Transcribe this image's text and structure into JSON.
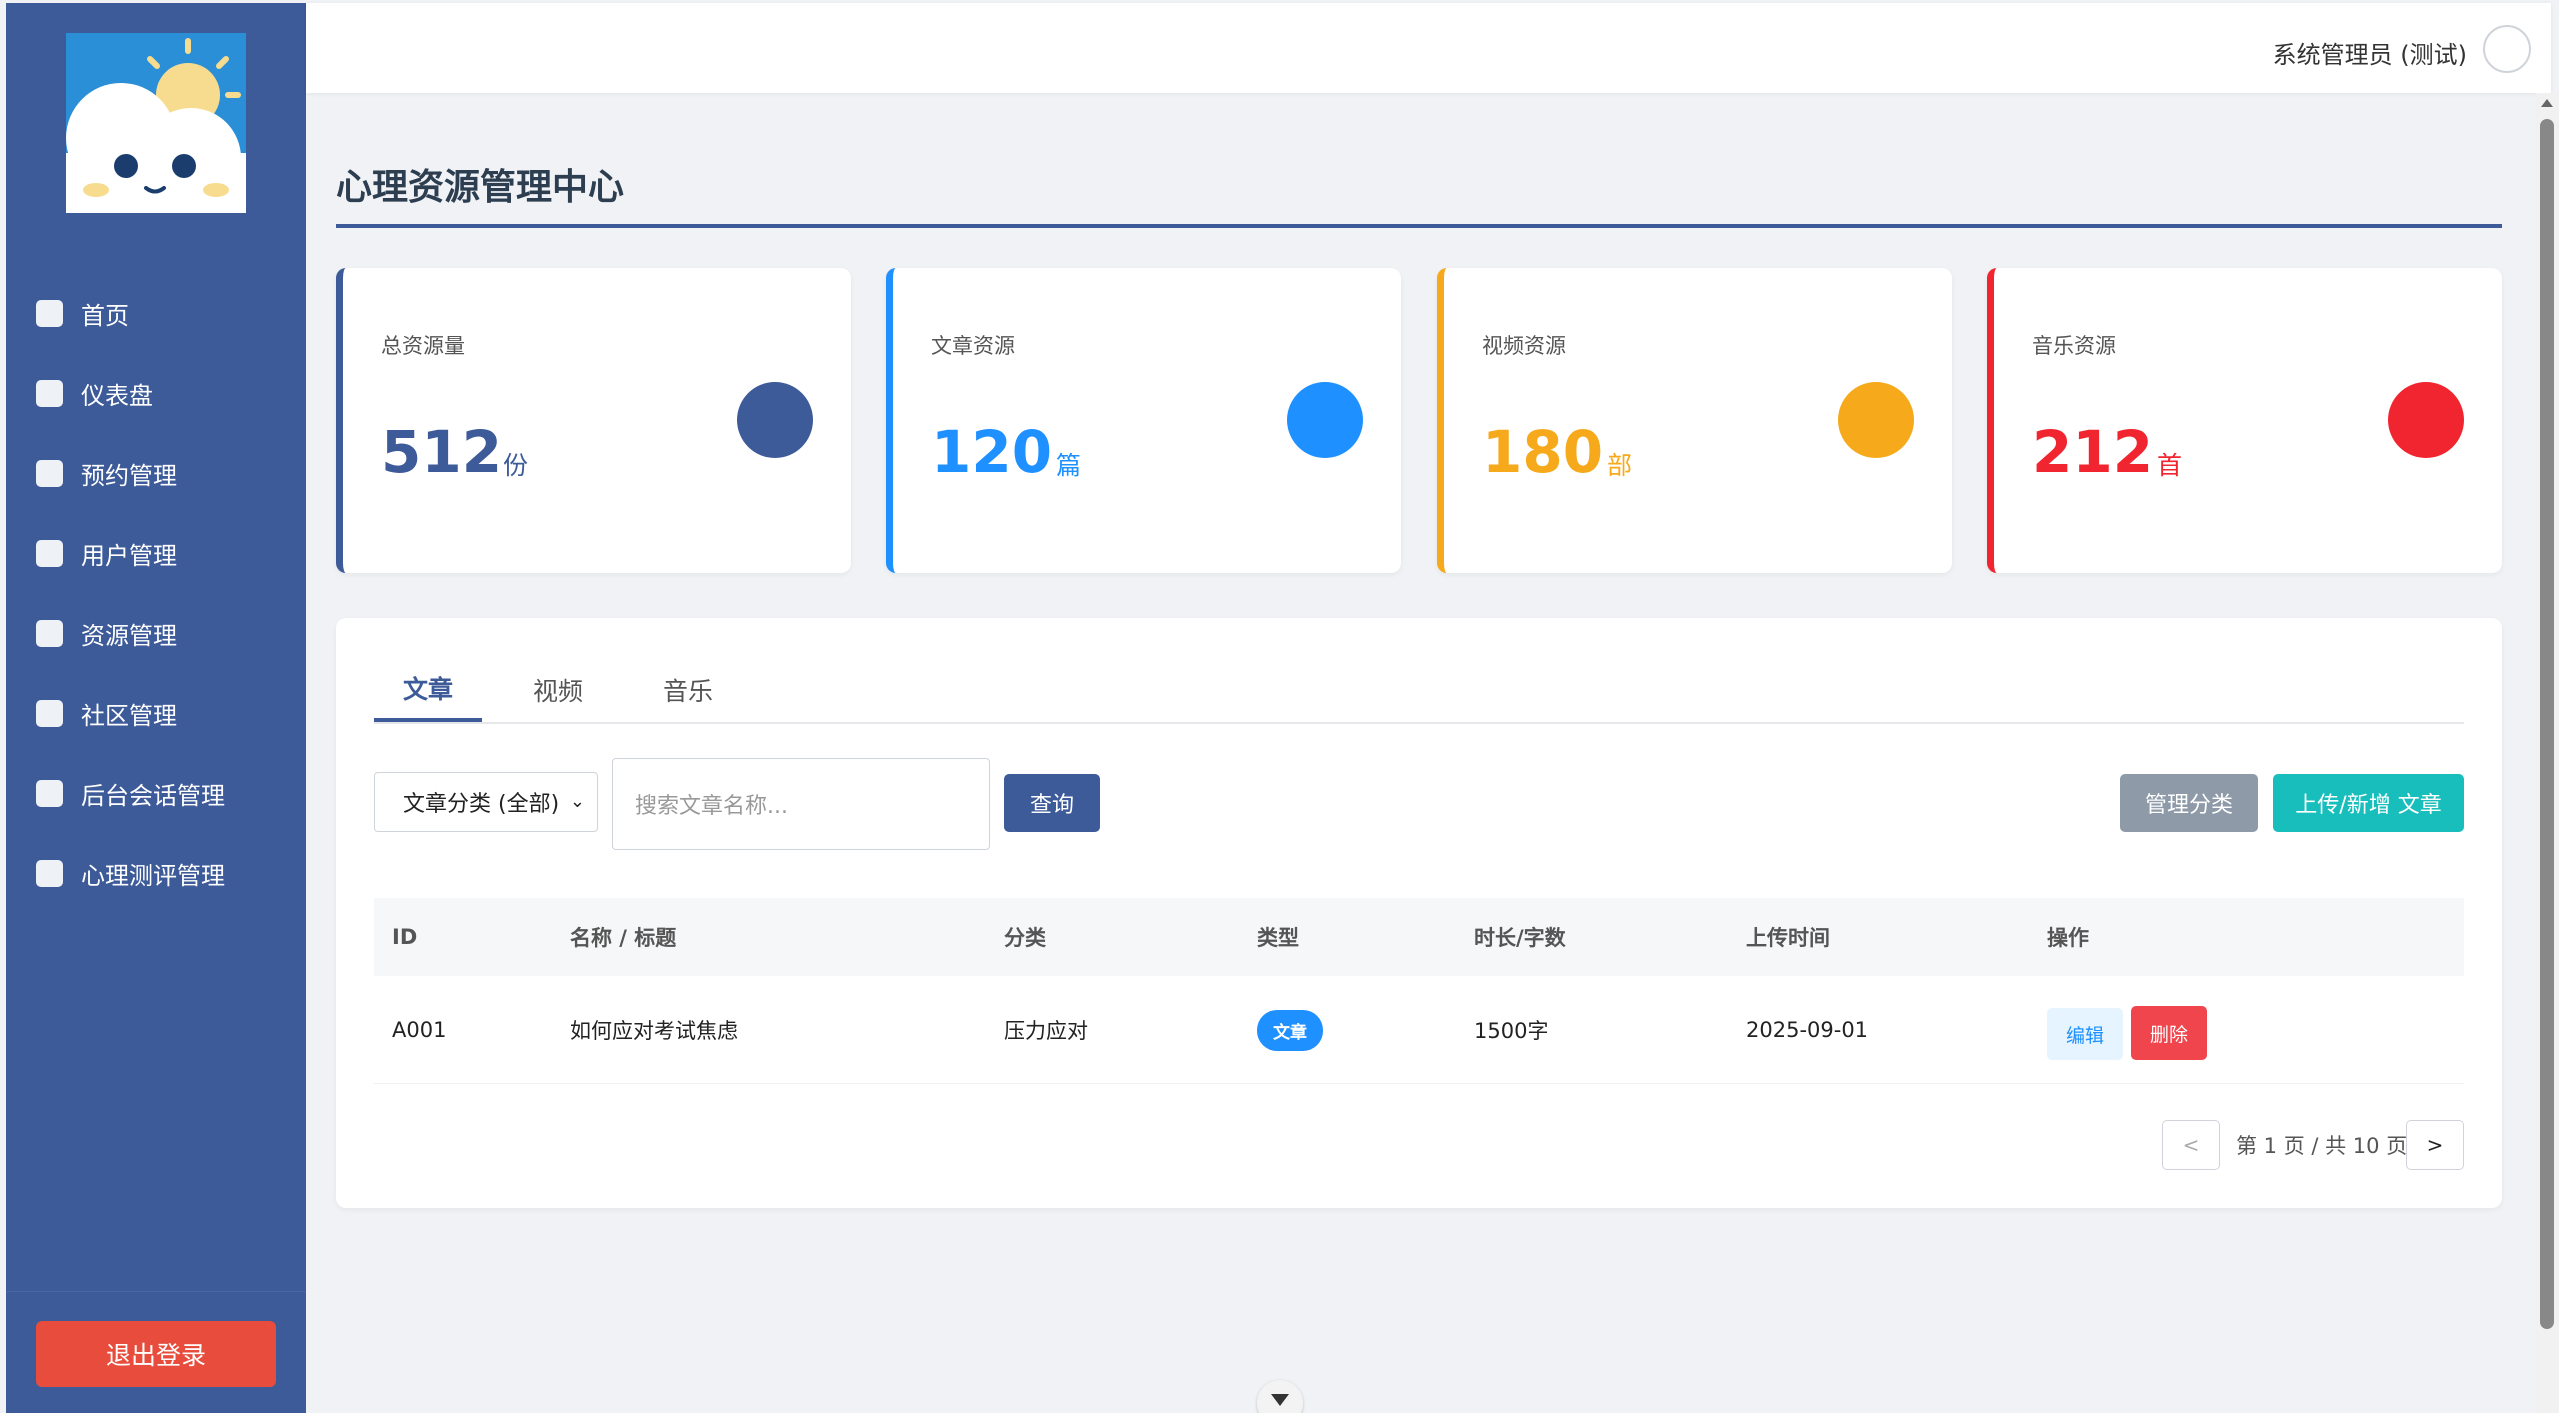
{
  "user": {
    "name": "系统管理员 (测试)"
  },
  "sidebar": {
    "items": [
      {
        "label": "首页"
      },
      {
        "label": "仪表盘"
      },
      {
        "label": "预约管理"
      },
      {
        "label": "用户管理"
      },
      {
        "label": "资源管理"
      },
      {
        "label": "社区管理"
      },
      {
        "label": "后台会话管理"
      },
      {
        "label": "心理测评管理"
      }
    ],
    "logout_label": "退出登录"
  },
  "page": {
    "title": "心理资源管理中心"
  },
  "stats": [
    {
      "label": "总资源量",
      "value": "512",
      "unit": "份",
      "color": "#3d5a99"
    },
    {
      "label": "文章资源",
      "value": "120",
      "unit": "篇",
      "color": "#1e90ff"
    },
    {
      "label": "视频资源",
      "value": "180",
      "unit": "部",
      "color": "#f5a91b"
    },
    {
      "label": "音乐资源",
      "value": "212",
      "unit": "首",
      "color": "#f0252f"
    }
  ],
  "tabs": [
    {
      "label": "文章"
    },
    {
      "label": "视频"
    },
    {
      "label": "音乐"
    }
  ],
  "filters": {
    "category_selected": "文章分类 (全部)",
    "search_placeholder": "搜索文章名称...",
    "query_label": "查询",
    "manage_category_label": "管理分类",
    "upload_label": "上传/新增 文章"
  },
  "table": {
    "headers": [
      "ID",
      "名称 / 标题",
      "分类",
      "类型",
      "时长/字数",
      "上传时间",
      "操作"
    ],
    "rows": [
      {
        "id": "A001",
        "title": "如何应对考试焦虑",
        "category": "压力应对",
        "type": "文章",
        "length": "1500字",
        "uploaded": "2025-09-01",
        "edit": "编辑",
        "delete": "删除"
      }
    ]
  },
  "pagination": {
    "prev": "<",
    "next": ">",
    "text": "第 1 页 / 共 10 页"
  },
  "icons": {
    "logo": "cloud-sun-mascot-logo",
    "avatar": "user-avatar-icon"
  }
}
